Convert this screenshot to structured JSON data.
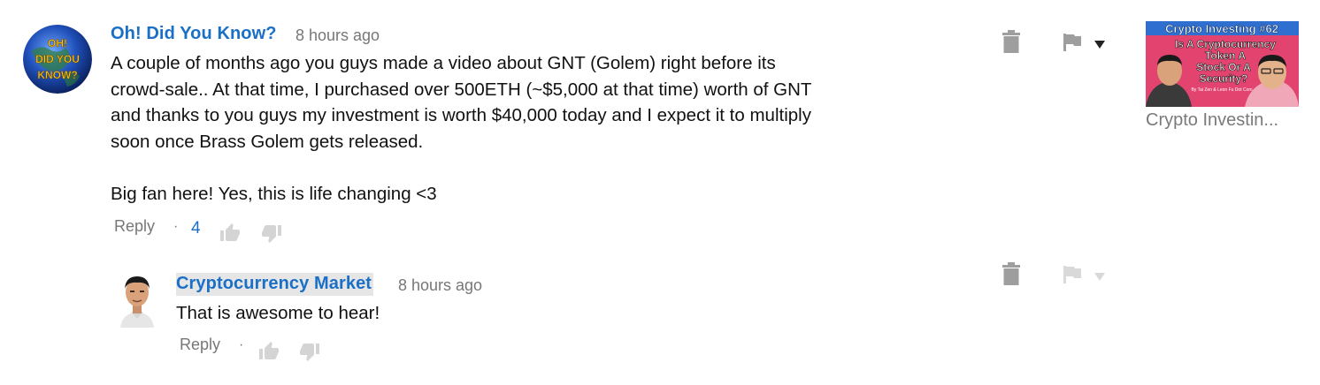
{
  "comment": {
    "author": "Oh! Did You Know?",
    "avatar_text": [
      "OH!",
      "DID YOU",
      "KNOW?"
    ],
    "timestamp": "8 hours ago",
    "body_lines": [
      "A couple of months ago you guys made a video about GNT (Golem) right before its",
      "crowd-sale.. At that time, I purchased over 500ETH (~$5,000 at that time) worth of GNT",
      "and thanks to you guys my investment is worth $40,000 today and I expect it to multiply",
      "soon once Brass Golem gets released.",
      "",
      "Big fan here! Yes, this is life changing <3"
    ],
    "reply_label": "Reply",
    "separator": "·",
    "like_count": "4"
  },
  "reply": {
    "author": "Cryptocurrency Market",
    "timestamp": "8 hours ago",
    "body": "That is awesome to hear!",
    "reply_label": "Reply",
    "separator": "·"
  },
  "video": {
    "thumbnail_text": {
      "headline": "Crypto Investing #62",
      "line1": "Is A Cryptocurrency",
      "line2": "Token A",
      "line3": "Stock Or A",
      "line4": "Security?",
      "byline": "By Tai Zen & Leon Fu Dot Com"
    },
    "title": "Crypto Investin..."
  },
  "icons": {
    "trash": "trash-icon",
    "flag": "flag-icon",
    "caret": "caret-down-icon",
    "thumb_up": "thumbs-up-icon",
    "thumb_down": "thumbs-down-icon"
  },
  "colors": {
    "link_blue": "#1a6fc7",
    "meta_gray": "#777777",
    "icon_gray": "#9e9e9e",
    "icon_light_gray": "#d4d4d4",
    "author_highlight": "#e6e6e6",
    "thumbnail_pink": "#e2436f",
    "thumbnail_blue": "#2f6fd0"
  }
}
